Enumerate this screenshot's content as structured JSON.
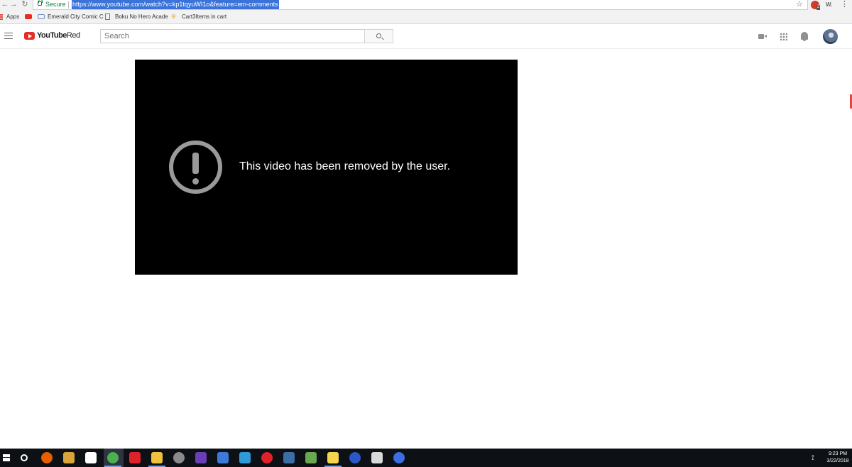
{
  "browser": {
    "secure_label": "Secure",
    "url": "https://www.youtube.com/watch?v=kp1tqyuWI1o&feature=em-comments",
    "back_glyph": "←",
    "forward_glyph": "→",
    "reload_glyph": "↻",
    "star_glyph": "☆",
    "ext_badge_count": "2",
    "ext_label": "W.",
    "menu_glyph": "⋮"
  },
  "bookmarks": [
    {
      "label": "Apps",
      "icon": "apps-grid-icon"
    },
    {
      "label": "",
      "icon": "youtube-icon"
    },
    {
      "label": "Emerald City Comic C",
      "icon": "emerald-city-icon"
    },
    {
      "label": "Boku No Hero Acade",
      "icon": "page-icon"
    },
    {
      "label": "Cart3Items in cart",
      "icon": "walmart-icon"
    }
  ],
  "youtube": {
    "brand": "YouTube",
    "brand_suffix": "Red",
    "search_placeholder": "Search",
    "header_icons": [
      "create-video-icon",
      "apps-icon",
      "notifications-bell-icon",
      "avatar"
    ]
  },
  "player": {
    "error_message": "This video has been removed by the user."
  },
  "taskbar": {
    "time": "9:23 PM",
    "date": "3/22/2018",
    "network_glyph": "⟟",
    "apps": [
      {
        "name": "firefox-icon",
        "color": "#e66000"
      },
      {
        "name": "file-explorer-alt-icon",
        "color": "#d9a53a"
      },
      {
        "name": "mail-icon",
        "color": "#ffffff"
      },
      {
        "name": "chrome-icon",
        "color": "#4caf50"
      },
      {
        "name": "screen-recorder-icon",
        "color": "#e0212a"
      },
      {
        "name": "file-explorer-icon",
        "color": "#f0c23b"
      },
      {
        "name": "clock-app-icon",
        "color": "#8a8a8a"
      },
      {
        "name": "hexagon-app-icon",
        "color": "#6a3fb5"
      },
      {
        "name": "arrows-app-icon",
        "color": "#3b7ad9"
      },
      {
        "name": "photoshop-icon",
        "color": "#2f9ad6"
      },
      {
        "name": "opera-icon",
        "color": "#e1212a"
      },
      {
        "name": "steam-icon",
        "color": "#3a6ea5"
      },
      {
        "name": "minecraft-icon",
        "color": "#6aa84f"
      },
      {
        "name": "sticky-notes-icon",
        "color": "#f5d64a"
      },
      {
        "name": "forward-app-icon",
        "color": "#2b58c9"
      },
      {
        "name": "paper-app-icon",
        "color": "#d9d9d9"
      },
      {
        "name": "media-player-icon",
        "color": "#3b6ee0"
      }
    ]
  }
}
